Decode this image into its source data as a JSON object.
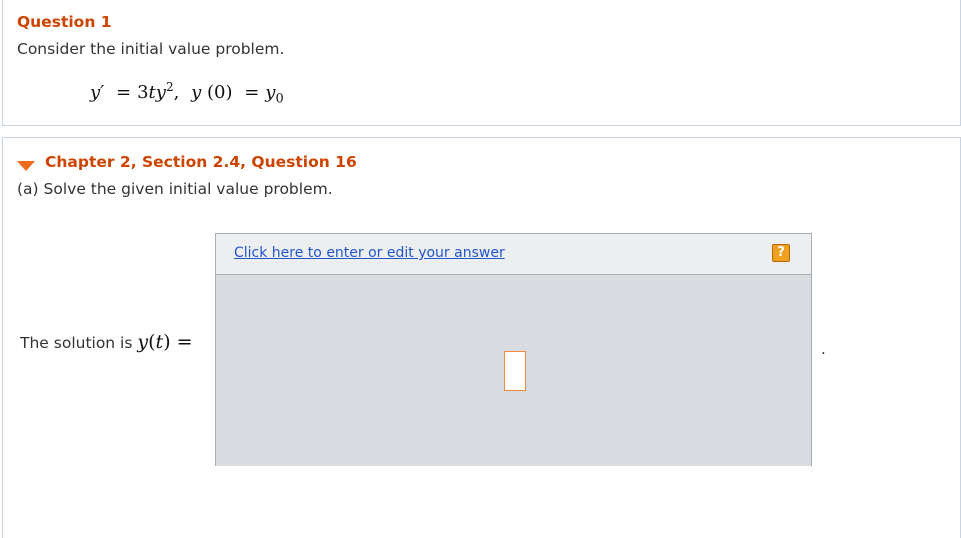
{
  "question": {
    "title": "Question 1",
    "prompt": "Consider the initial value problem.",
    "equation": {
      "lhs": "y′",
      "equals1": "=",
      "coef": "3",
      "t": "t",
      "y": "y",
      "exp": "2",
      "comma": ",",
      "func": "y",
      "arg": "(0)",
      "equals2": "=",
      "rhs_var": "y",
      "rhs_sub": "0"
    }
  },
  "chapter": {
    "title": "Chapter 2, Section 2.4, Question 16",
    "prompt": "(a) Solve the given initial value problem.",
    "solution_label": "The solution is",
    "solution_func": "y",
    "solution_arg_open": "(",
    "solution_arg": "t",
    "solution_arg_close": ")",
    "solution_equals": "=",
    "answer_link": "Click here to enter or edit your answer",
    "help_label": "?",
    "trailing_period": "."
  },
  "colors": {
    "heading": "#cc4400",
    "chevron": "#f06a1c",
    "link": "#2255cc",
    "answer_area": "#d8dce0",
    "help_button": "#f0a020",
    "placeholder_border": "#f08a40"
  },
  "icons": {
    "collapse": "chevron-down-icon",
    "help": "help-icon"
  }
}
